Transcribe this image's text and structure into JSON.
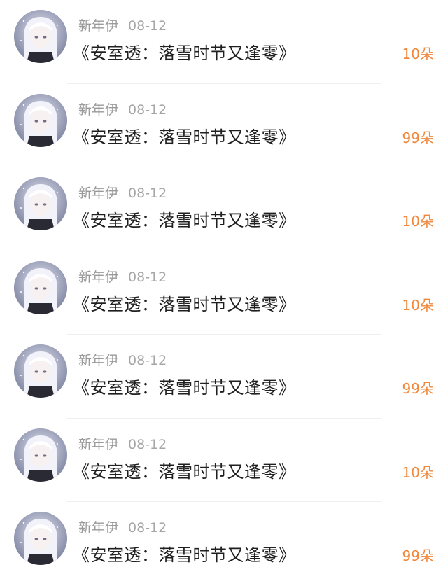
{
  "gift_list": {
    "items": [
      {
        "user": "新年伊",
        "date": "08-12",
        "title": "《安室透：落雪时节又逢零》",
        "amount": "10朵"
      },
      {
        "user": "新年伊",
        "date": "08-12",
        "title": "《安室透：落雪时节又逢零》",
        "amount": "99朵"
      },
      {
        "user": "新年伊",
        "date": "08-12",
        "title": "《安室透：落雪时节又逢零》",
        "amount": "10朵"
      },
      {
        "user": "新年伊",
        "date": "08-12",
        "title": "《安室透：落雪时节又逢零》",
        "amount": "10朵"
      },
      {
        "user": "新年伊",
        "date": "08-12",
        "title": "《安室透：落雪时节又逢零》",
        "amount": "99朵"
      },
      {
        "user": "新年伊",
        "date": "08-12",
        "title": "《安室透：落雪时节又逢零》",
        "amount": "10朵"
      },
      {
        "user": "新年伊",
        "date": "08-12",
        "title": "《安室透：落雪时节又逢零》",
        "amount": "99朵"
      }
    ]
  },
  "colors": {
    "amount_accent": "#f0883c",
    "username": "#9a9a9a",
    "title": "#1f1f1f",
    "divider": "#efefef"
  },
  "icons": {
    "avatar": "user-avatar-image"
  }
}
